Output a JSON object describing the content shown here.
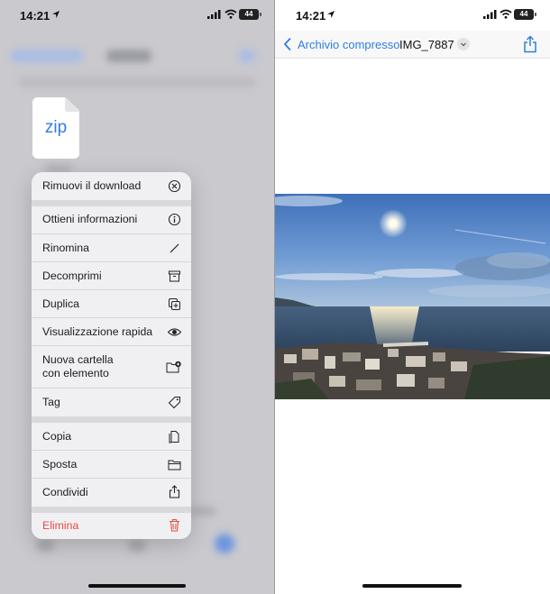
{
  "status_bar": {
    "time": "14:21",
    "battery": "44"
  },
  "left": {
    "file_icon_label": "zip",
    "context_menu": {
      "groups": [
        [
          {
            "label": "Rimuovi il download",
            "icon": "xmark-circle-icon"
          }
        ],
        [
          {
            "label": "Ottieni informazioni",
            "icon": "info-circle-icon"
          },
          {
            "label": "Rinomina",
            "icon": "pencil-icon"
          },
          {
            "label": "Decomprimi",
            "icon": "archive-box-icon"
          },
          {
            "label": "Duplica",
            "icon": "duplicate-icon"
          },
          {
            "label": "Visualizzazione rapida",
            "icon": "eye-icon"
          },
          {
            "label_line1": "Nuova cartella",
            "label_line2": "con elemento",
            "icon": "folder-badge-plus-icon"
          },
          {
            "label": "Tag",
            "icon": "tag-icon"
          }
        ],
        [
          {
            "label": "Copia",
            "icon": "copy-doc-icon"
          },
          {
            "label": "Sposta",
            "icon": "folder-icon"
          },
          {
            "label": "Condividi",
            "icon": "share-icon"
          }
        ],
        [
          {
            "label": "Elimina",
            "icon": "trash-icon",
            "destructive": true
          }
        ]
      ]
    }
  },
  "right": {
    "nav": {
      "back_label": "Archivio compresso",
      "title": "IMG_7887"
    },
    "photo_description_icon": "landscape-photo"
  },
  "colors": {
    "accent": "#2f7de1",
    "destructive": "#ea4a42",
    "menu_bg": "#f0f0f2"
  }
}
